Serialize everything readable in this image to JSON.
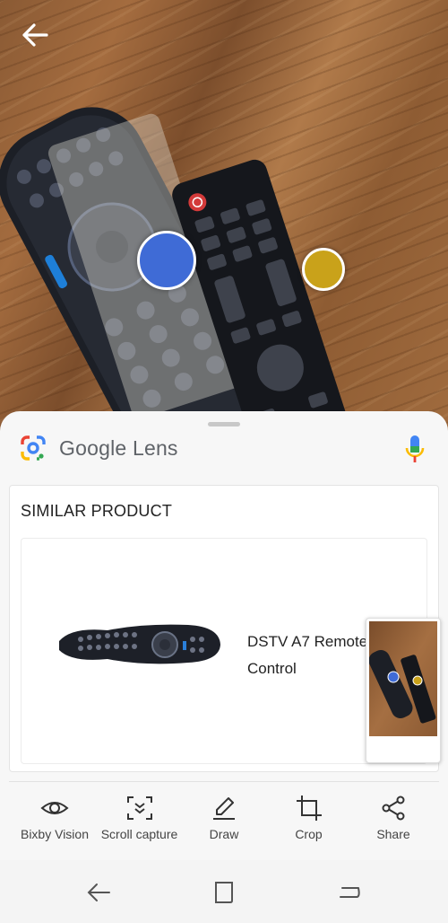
{
  "header": {
    "back_icon": "arrow-left-icon"
  },
  "lens": {
    "title": "Google Lens",
    "mic_icon": "microphone-icon",
    "colors": {
      "blue": "#4285F4",
      "red": "#EA4335",
      "yellow": "#FBBC05",
      "green": "#34A853"
    }
  },
  "result_card": {
    "section_title": "SIMILAR PRODUCT",
    "product_name": "DSTV A7 Remote Control"
  },
  "toolbar": {
    "items": [
      {
        "label": "Bixby Vision",
        "icon": "eye-icon"
      },
      {
        "label": "Scroll capture",
        "icon": "scroll-capture-icon"
      },
      {
        "label": "Draw",
        "icon": "pencil-icon"
      },
      {
        "label": "Crop",
        "icon": "crop-icon"
      },
      {
        "label": "Share",
        "icon": "share-icon"
      }
    ]
  },
  "navigation": {
    "back_icon": "nav-back-icon",
    "home_icon": "nav-home-icon",
    "recents_icon": "nav-recents-icon"
  }
}
